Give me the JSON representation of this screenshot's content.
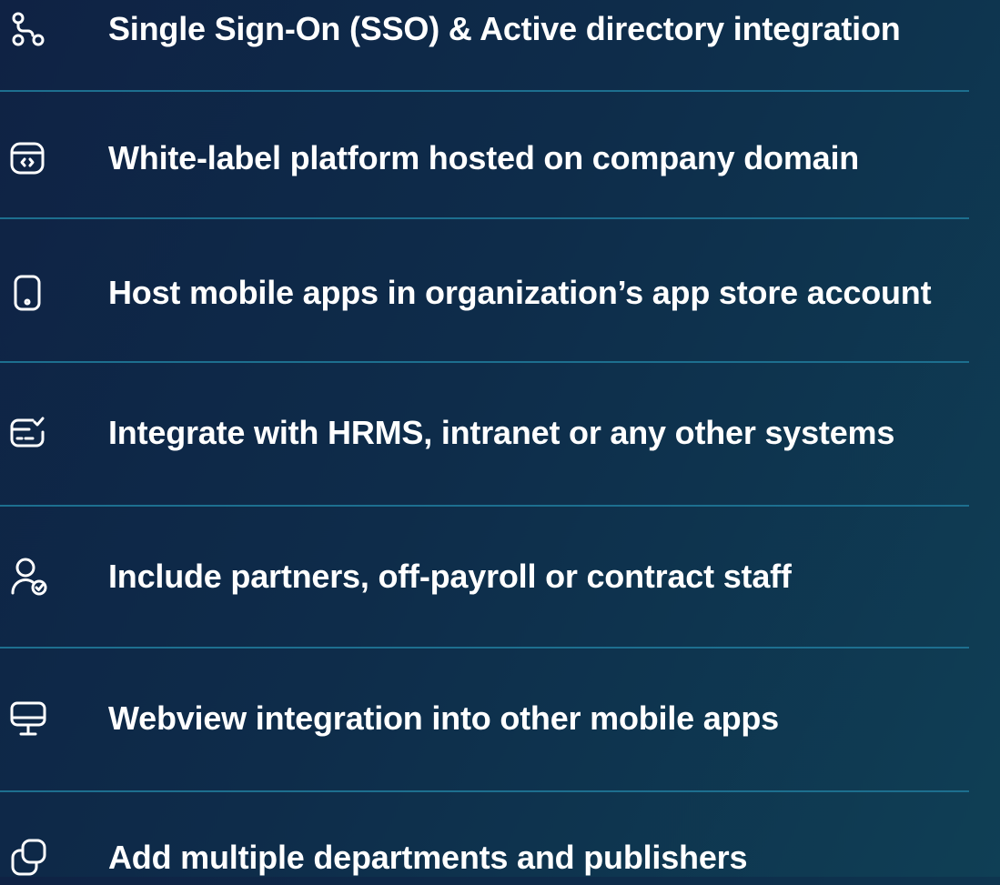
{
  "features": [
    {
      "label": "Single Sign-On (SSO) & Active directory integration",
      "icon": "route-icon"
    },
    {
      "label": "White-label platform hosted on company domain",
      "icon": "browser-code-icon"
    },
    {
      "label": "Host mobile apps in organization’s app store account",
      "icon": "mobile-phone-icon"
    },
    {
      "label": "Integrate with HRMS, intranet or any other systems",
      "icon": "card-check-icon"
    },
    {
      "label": "Include partners, off-payroll or contract staff",
      "icon": "user-check-icon"
    },
    {
      "label": "Webview integration into other mobile apps",
      "icon": "monitor-icon"
    },
    {
      "label": "Add multiple departments and publishers",
      "icon": "copy-icon"
    }
  ],
  "colors": {
    "text": "#ffffff",
    "divider": "#1d6f8f",
    "background_start": "#0f2244",
    "background_end": "#0f3f55"
  }
}
